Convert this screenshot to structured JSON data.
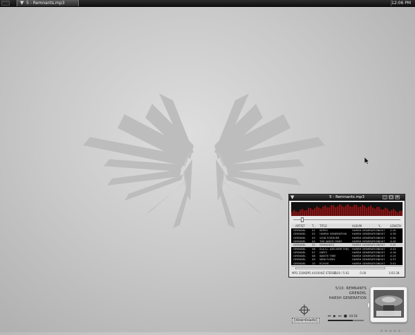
{
  "taskbar": {
    "task_title": "5 - Remnants.mp3",
    "clock": "12:06 PM"
  },
  "desktop": {
    "icon_label": "[downloads]"
  },
  "player": {
    "title": "5 - Remnants.mp3",
    "window_buttons": [
      "_",
      "□",
      "×"
    ],
    "columns": [
      "ARTIST",
      "T...",
      "TITLE",
      "ALBUM",
      "Y...",
      "LENGTH"
    ],
    "tracks": [
      {
        "artist": "GRENDEL",
        "num": "01",
        "title": "INTRO",
        "album": "HARSH GENERATION",
        "year": "2007",
        "length": "2:20"
      },
      {
        "artist": "GRENDEL",
        "num": "02",
        "title": "HARSH GENERATION",
        "album": "HARSH GENERATION",
        "year": "2007",
        "length": "4:39"
      },
      {
        "artist": "GRENDEL",
        "num": "03",
        "title": "VOID FOREVER",
        "album": "HARSH GENERATION",
        "year": "2007",
        "length": "4:50"
      },
      {
        "artist": "GRENDEL",
        "num": "04",
        "title": "THE JADED ONES",
        "album": "HARSH GENERATION",
        "year": "2007",
        "length": "4:40"
      },
      {
        "artist": "GRENDEL",
        "num": "05",
        "title": "REMNANTS",
        "album": "HARSH GENERATION",
        "year": "2007",
        "length": "5:02"
      },
      {
        "artist": "GRENDEL",
        "num": "06",
        "title": "D.A.I.L. (DELIVER THE)",
        "album": "HARSH GENERATION",
        "year": "2007",
        "length": "4:41"
      },
      {
        "artist": "GRENDEL",
        "num": "07",
        "title": "DIRTY",
        "album": "HARSH GENERATION",
        "year": "2007",
        "length": "4:16"
      },
      {
        "artist": "GRENDEL",
        "num": "08",
        "title": "WASTE TIME",
        "album": "HARSH GENERATION",
        "year": "2007",
        "length": "4:15"
      },
      {
        "artist": "GRENDEL",
        "num": "09",
        "title": "NEW FLESH",
        "album": "HARSH GENERATION",
        "year": "2007",
        "length": "4:37"
      },
      {
        "artist": "GRENDEL",
        "num": "10",
        "title": "ECHOS",
        "album": "HARSH GENERATION",
        "year": "2007",
        "length": "3:51"
      }
    ],
    "playing_index": 4,
    "status": {
      "format": "MP3 320KBPS 44100HZ STEREO",
      "time": "0:20 / 5:02",
      "volume": "-5.00",
      "total": "3:02:38"
    },
    "seek_fraction": 0.07
  },
  "now_playing": {
    "track": "5/10: REMNANTS",
    "artist": "GRENDEL",
    "album": "HARSH GENERATION",
    "elapsed": "04:18",
    "progress_fraction": 0.7,
    "rating_stars": 0
  }
}
